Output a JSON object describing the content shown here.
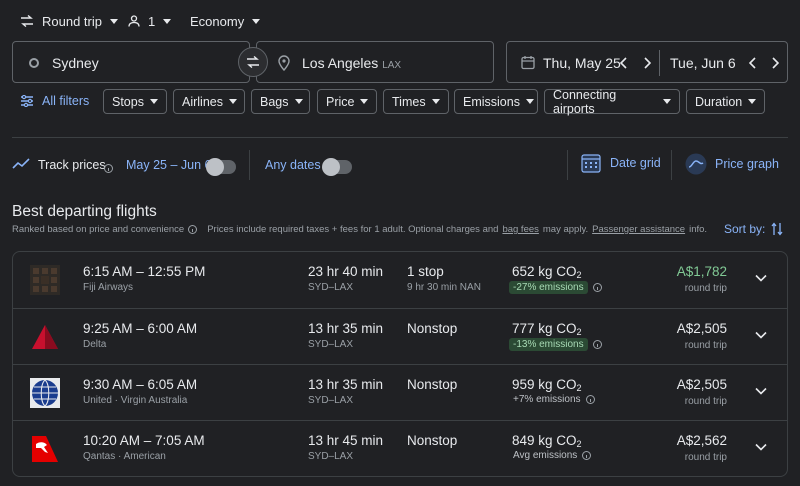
{
  "trip_type": "Round trip",
  "passengers": "1",
  "cabin": "Economy",
  "origin": {
    "city": "Sydney"
  },
  "destination": {
    "city": "Los Angeles",
    "code": "LAX"
  },
  "depart_date": "Thu, May 25",
  "return_date": "Tue, Jun 6",
  "filters": {
    "all_filters": "All filters",
    "chips": [
      "Stops",
      "Airlines",
      "Bags",
      "Price",
      "Times",
      "Emissions",
      "Connecting airports",
      "Duration"
    ]
  },
  "track": {
    "label": "Track prices",
    "range": "May 25 – Jun 6",
    "any_dates": "Any dates",
    "date_grid": "Date grid",
    "price_graph": "Price graph"
  },
  "results": {
    "title": "Best departing flights",
    "subtitle": "Ranked based on price and convenience",
    "disclaimer_pre": "Prices include required taxes + fees for 1 adult. Optional charges and",
    "bag_fees": "bag fees",
    "disclaimer_mid": "may apply.",
    "passenger_assistance": "Passenger assistance",
    "disclaimer_end": "info.",
    "sort_by": "Sort by:"
  },
  "flights": [
    {
      "times": "6:15 AM – 12:55 PM",
      "airline": "Fiji Airways",
      "duration": "23 hr 40 min",
      "route": "SYD–LAX",
      "stops": "1 stop",
      "layover": "9 hr 30 min NAN",
      "co2": "652 kg CO",
      "emissions": "-27% emissions",
      "emissions_badge": true,
      "price": "A$1,782",
      "price_note": "round trip",
      "cheapest": true,
      "logo": "fiji-airways-logo"
    },
    {
      "times": "9:25 AM – 6:00 AM",
      "airline": "Delta",
      "duration": "13 hr 35 min",
      "route": "SYD–LAX",
      "stops": "Nonstop",
      "layover": "",
      "co2": "777 kg CO",
      "emissions": "-13% emissions",
      "emissions_badge": true,
      "price": "A$2,505",
      "price_note": "round trip",
      "cheapest": false,
      "logo": "delta-logo"
    },
    {
      "times": "9:30 AM – 6:05 AM",
      "airline": "United · Virgin Australia",
      "duration": "13 hr 35 min",
      "route": "SYD–LAX",
      "stops": "Nonstop",
      "layover": "",
      "co2": "959 kg CO",
      "emissions": "+7% emissions",
      "emissions_badge": false,
      "price": "A$2,505",
      "price_note": "round trip",
      "cheapest": false,
      "logo": "united-logo"
    },
    {
      "times": "10:20 AM – 7:05 AM",
      "airline": "Qantas · American",
      "duration": "13 hr 45 min",
      "route": "SYD–LAX",
      "stops": "Nonstop",
      "layover": "",
      "co2": "849 kg CO",
      "emissions": "Avg emissions",
      "emissions_badge": false,
      "price": "A$2,562",
      "price_note": "round trip",
      "cheapest": false,
      "logo": "qantas-logo"
    }
  ],
  "co2_subscript": "2",
  "colors": {
    "background": "#202124",
    "accent": "#8ab4f8",
    "cheap_price": "#81c995",
    "emissions_badge_bg": "#2b4a34",
    "border": "#5f6368"
  }
}
